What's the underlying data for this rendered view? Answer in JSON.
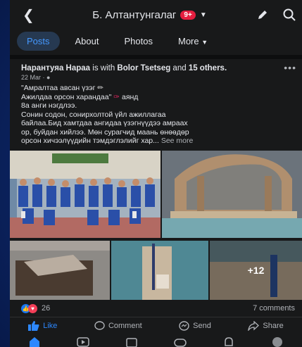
{
  "header": {
    "page_name": "Б. Алтантунгалаг",
    "notif_badge": "9+"
  },
  "tabs": [
    {
      "label": "Posts",
      "active": true
    },
    {
      "label": "About",
      "active": false
    },
    {
      "label": "Photos",
      "active": false
    },
    {
      "label": "More",
      "active": false
    }
  ],
  "post": {
    "author": "Нарантуяа Нараа",
    "with_text": " is with ",
    "tagged": "Bolor Tsetseg",
    "and_text": " and ",
    "others": "15 others",
    "date": "22 Mar ·",
    "line1": "\"Амралтаа авсан үзэг",
    "line2a": "Ажилдаа орсон харандаа\"",
    "line2b": " аянд",
    "line3": "8а анги нэгдлээ.",
    "line4": "Сонин содон, сонирхолтой үйл ажиллагаа",
    "line5": "байлаа.Бид хамтдаа ангидаа үзэгнүүдээ амраах",
    "line6": "ор, буйдан хийлээ. Мөн сурагчид маань өнөөдөр",
    "line7": "орсон хичээлүүдийн тэмдэглэлийг хар...",
    "see_more": "See more",
    "more_photos": "+12"
  },
  "reactions": {
    "count": "26",
    "comments": "7 comments"
  },
  "actions": {
    "like": "Like",
    "comment": "Comment",
    "send": "Send",
    "share": "Share"
  },
  "colors": {
    "accent": "#2d88ff",
    "background": "#18191a",
    "badge": "#e41e3f"
  }
}
